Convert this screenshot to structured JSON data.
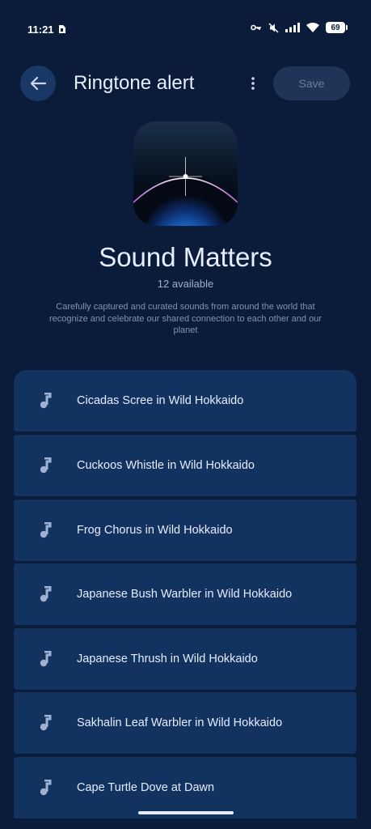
{
  "status_bar": {
    "time": "11:21",
    "battery": "69",
    "icons": [
      "sim-icon",
      "vpn-key-icon",
      "mute-icon",
      "signal-icon",
      "wifi-icon",
      "battery-icon"
    ]
  },
  "header": {
    "title": "Ringtone alert",
    "save_label": "Save",
    "icons": [
      "back-arrow-icon",
      "more-vert-icon"
    ]
  },
  "collection": {
    "title": "Sound Matters",
    "available": "12 available",
    "description": "Carefully captured and curated sounds from around the world that recognize and celebrate our shared connection to each other and our planet"
  },
  "ringtones": [
    {
      "label": "Cicadas Scree in Wild Hokkaido"
    },
    {
      "label": "Cuckoos Whistle in Wild Hokkaido"
    },
    {
      "label": "Frog Chorus in Wild Hokkaido"
    },
    {
      "label": "Japanese Bush Warbler in Wild Hokkaido"
    },
    {
      "label": "Japanese Thrush in Wild Hokkaido"
    },
    {
      "label": "Sakhalin Leaf Warbler in Wild Hokkaido"
    },
    {
      "label": "Cape Turtle Dove at Dawn"
    }
  ],
  "colors": {
    "background": "#0b1c3a",
    "list_item": "#12335f",
    "accent_button": "#1a3866"
  }
}
